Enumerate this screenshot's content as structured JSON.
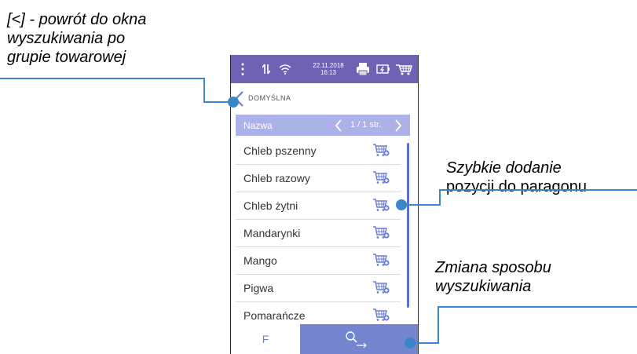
{
  "annotations": {
    "back": [
      "[<] - powrót do okna",
      "wyszukiwania po",
      "grupie towarowej"
    ],
    "quick_add": [
      "Szybkie dodanie",
      "pozycji do paragonu"
    ],
    "search_mode": [
      "Zmiana sposobu",
      "wyszukiwania"
    ]
  },
  "status_bar": {
    "date": "22.11.2018",
    "time": "16:13",
    "icons": [
      "menu-dots-icon",
      "signal-icon",
      "wifi-icon",
      "printer-icon",
      "battery-icon",
      "cart-icon"
    ]
  },
  "group": {
    "label": "DOMYŚLNA"
  },
  "list_header": {
    "column": "Nazwa",
    "page": "1 / 1 str."
  },
  "products": [
    {
      "name": "Chleb pszenny"
    },
    {
      "name": "Chleb razowy"
    },
    {
      "name": "Chleb żytni"
    },
    {
      "name": "Mandarynki"
    },
    {
      "name": "Mango"
    },
    {
      "name": "Pigwa"
    },
    {
      "name": "Pomarańcze"
    }
  ],
  "bottom": {
    "f_label": "F"
  },
  "colors": {
    "accent": "#6f61b3",
    "header": "#aab2e8",
    "button": "#7484cf",
    "callout": "#3b86c8"
  }
}
